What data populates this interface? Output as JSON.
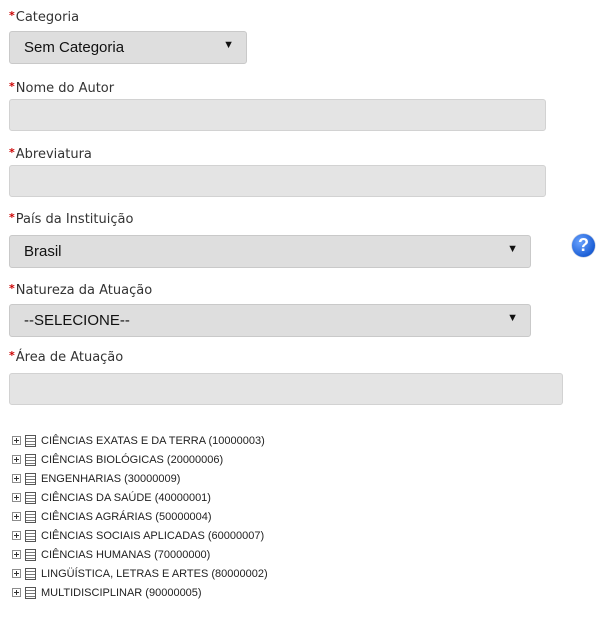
{
  "form": {
    "required_mark": "*",
    "categoria": {
      "label": "Categoria",
      "value": "Sem Categoria"
    },
    "nome_autor": {
      "label": "Nome do Autor",
      "value": ""
    },
    "abreviatura": {
      "label": "Abreviatura",
      "value": ""
    },
    "pais": {
      "label": "País da Instituição",
      "value": "Brasil"
    },
    "natureza": {
      "label": "Natureza da Atuação",
      "value": "--SELECIONE--"
    },
    "area": {
      "label": "Área de Atuação",
      "value": ""
    },
    "help_glyph": "?"
  },
  "icons": {
    "help": "help-question-icon",
    "expand": "plus-box-icon",
    "node": "document-icon"
  },
  "tree": [
    {
      "label": "CIÊNCIAS EXATAS E DA TERRA (10000003)"
    },
    {
      "label": "CIÊNCIAS BIOLÓGICAS (20000006)"
    },
    {
      "label": "ENGENHARIAS (30000009)"
    },
    {
      "label": "CIÊNCIAS DA SAÚDE (40000001)"
    },
    {
      "label": "CIÊNCIAS AGRÁRIAS (50000004)"
    },
    {
      "label": "CIÊNCIAS SOCIAIS APLICADAS (60000007)"
    },
    {
      "label": "CIÊNCIAS HUMANAS (70000000)"
    },
    {
      "label": "LINGÜÍSTICA, LETRAS E ARTES (80000002)"
    },
    {
      "label": "MULTIDISCIPLINAR (90000005)"
    }
  ]
}
